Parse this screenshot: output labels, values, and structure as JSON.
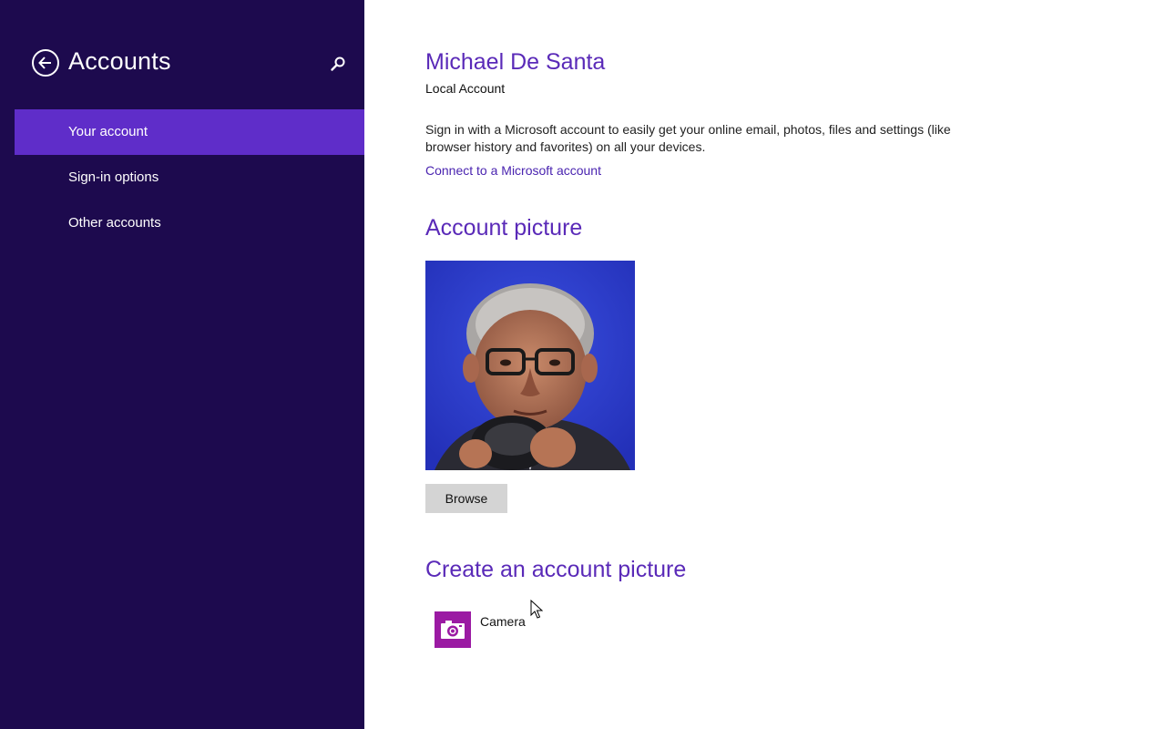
{
  "sidebar": {
    "title": "Accounts",
    "back_icon": "back-arrow-icon",
    "search_icon": "search-icon",
    "items": [
      {
        "label": "Your account",
        "selected": true
      },
      {
        "label": "Sign-in options",
        "selected": false
      },
      {
        "label": "Other accounts",
        "selected": false
      }
    ]
  },
  "account": {
    "name": "Michael De Santa",
    "type": "Local Account",
    "description": "Sign in with a Microsoft account to easily get your online email, photos, files and settings (like browser history and favorites) on all your devices.",
    "connect_link": "Connect to a Microsoft account"
  },
  "picture": {
    "heading": "Account picture",
    "browse_label": "Browse"
  },
  "create": {
    "heading": "Create an account picture",
    "apps": [
      {
        "label": "Camera",
        "icon": "camera-icon"
      }
    ]
  },
  "colors": {
    "sidebar_bg": "#1d0a4e",
    "selected_bg": "#5f2dc9",
    "accent_text": "#5a2ab8",
    "camera_tile": "#9b1aa3"
  }
}
